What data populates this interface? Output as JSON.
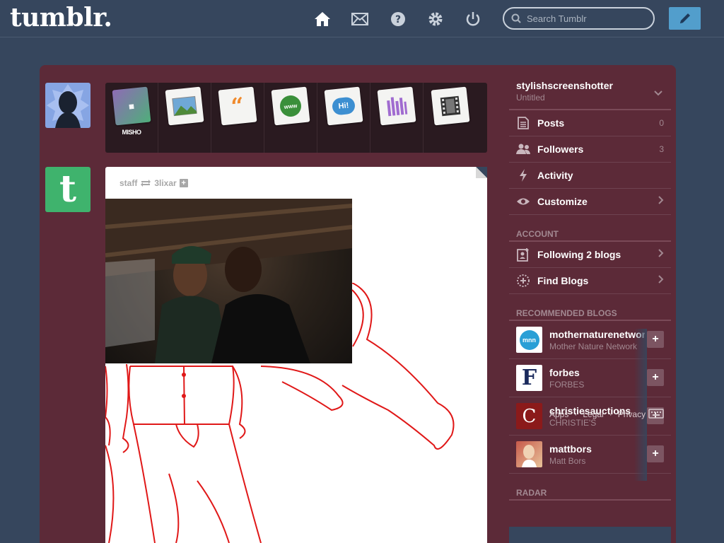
{
  "header": {
    "logo": "tumblr.",
    "search_placeholder": "Search Tumblr",
    "nav_icons": [
      "home-icon",
      "mail-icon",
      "help-icon",
      "gear-icon",
      "power-icon"
    ],
    "compose_icon": "pencil-icon"
  },
  "post_types": [
    {
      "name": "text",
      "label": "MISHO"
    },
    {
      "name": "photo",
      "label": ""
    },
    {
      "name": "quote",
      "label": ""
    },
    {
      "name": "link",
      "label": "www"
    },
    {
      "name": "chat",
      "label": "Hi!"
    },
    {
      "name": "audio",
      "label": ""
    },
    {
      "name": "video",
      "label": ""
    }
  ],
  "post": {
    "author": "staff",
    "reblog_from": "3lixar"
  },
  "sidebar": {
    "blog_name": "stylishscreenshotter",
    "blog_title": "Untitled",
    "items": [
      {
        "label": "Posts",
        "count": "0",
        "icon": "posts-icon"
      },
      {
        "label": "Followers",
        "count": "3",
        "icon": "followers-icon"
      },
      {
        "label": "Activity",
        "count": "",
        "icon": "lightning-icon"
      },
      {
        "label": "Customize",
        "count": "",
        "icon": "eye-icon"
      }
    ],
    "account_title": "ACCOUNT",
    "account_items": [
      {
        "label": "Following 2 blogs",
        "icon": "following-icon"
      },
      {
        "label": "Find Blogs",
        "icon": "find-blogs-icon"
      }
    ],
    "recommended_title": "RECOMMENDED BLOGS",
    "recommended": [
      {
        "name": "mothernaturenetwork",
        "sub": "Mother Nature Network",
        "avatar_text": "mnn",
        "color": "#2a9fd6"
      },
      {
        "name": "forbes",
        "sub": "FORBES",
        "avatar_text": "F",
        "color": "#ffffff"
      },
      {
        "name": "christiesauctions",
        "sub": "CHRISTIE'S",
        "avatar_text": "C",
        "color": "#8b1a1a"
      },
      {
        "name": "mattbors",
        "sub": "Matt Bors",
        "avatar_text": "",
        "color": "#c7594a"
      }
    ],
    "radar_title": "RADAR",
    "footer_links": [
      "Apps",
      "Legal",
      "Privacy"
    ]
  },
  "colors": {
    "background": "#36465d",
    "main_panel": "#5c2a38",
    "compose": "#529ecc"
  }
}
